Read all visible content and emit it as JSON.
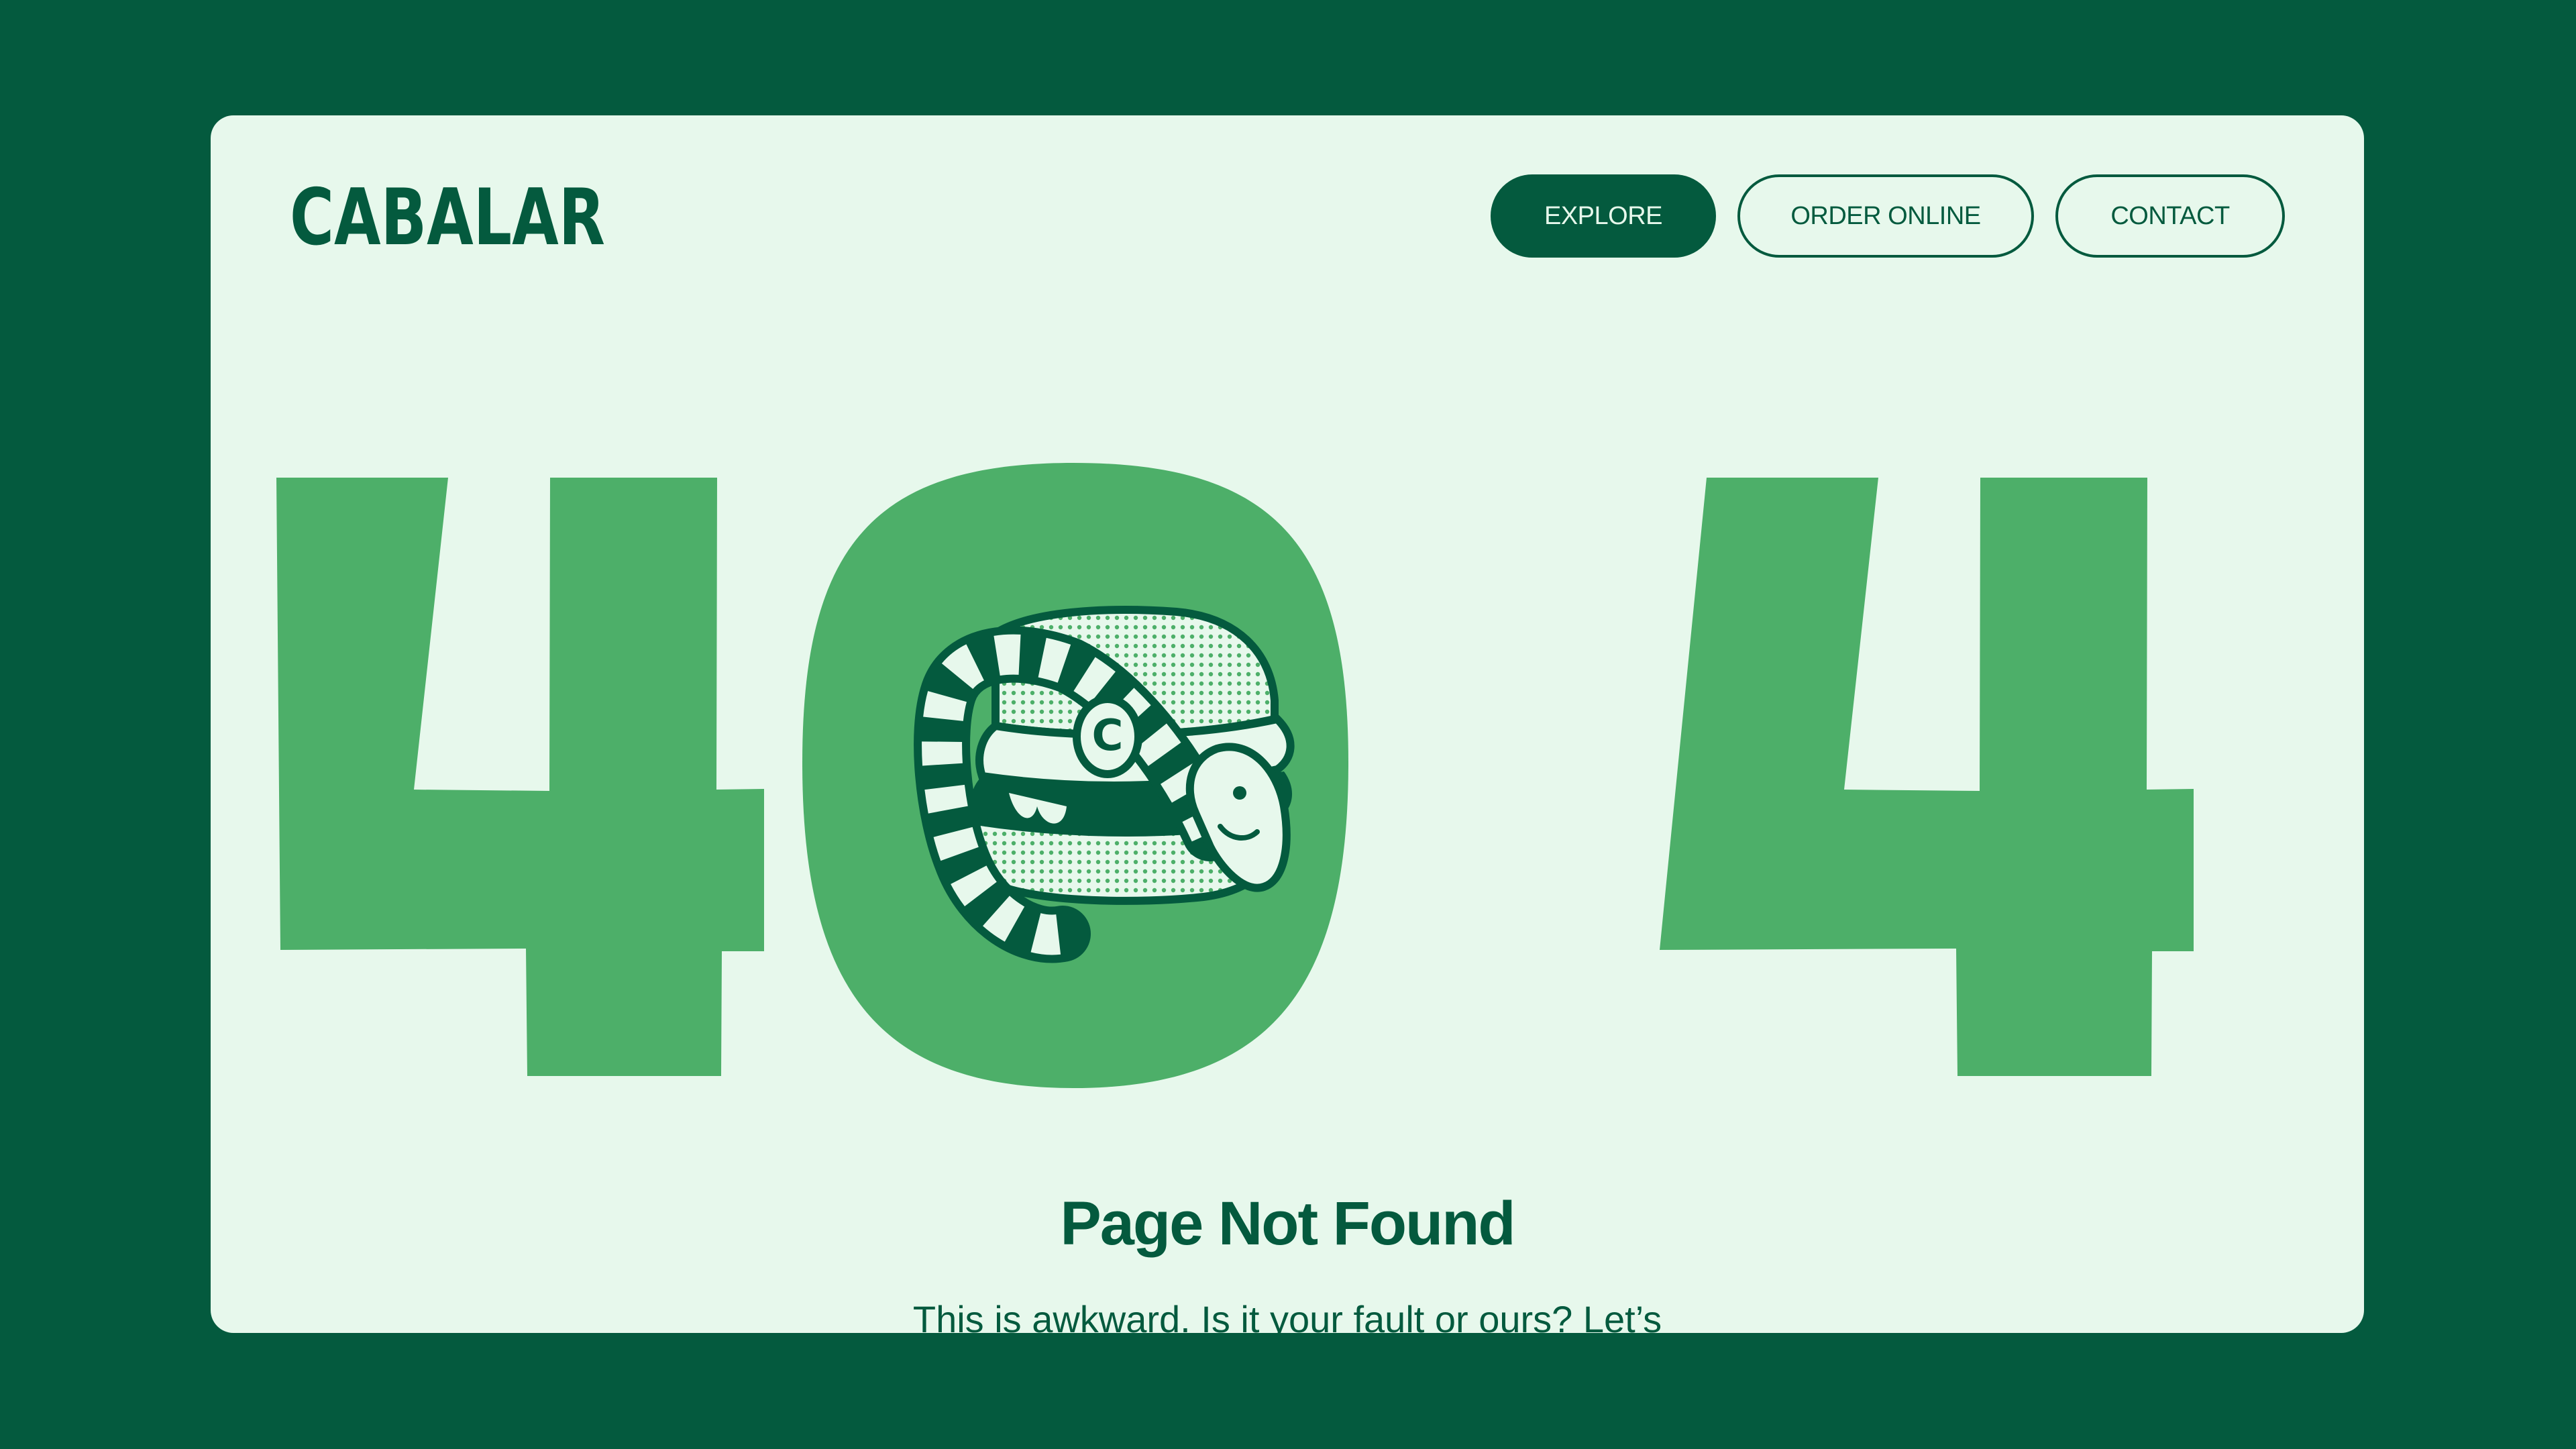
{
  "brand": {
    "logo_text": "CABALAR"
  },
  "nav": {
    "explore_label": "EXPLORE",
    "order_label": "ORDER ONLINE",
    "contact_label": "CONTACT"
  },
  "error": {
    "code": "404",
    "title": "Page Not Found",
    "message": "This is awkward. Is it your fault or ours? Let’s"
  },
  "illustration": {
    "subject": "snake wrapped around a burger",
    "emblem_letter": "C"
  },
  "colors": {
    "background": "#045a3e",
    "card": "#e7f8ec",
    "accent": "#4daf69",
    "text": "#045a3e"
  }
}
